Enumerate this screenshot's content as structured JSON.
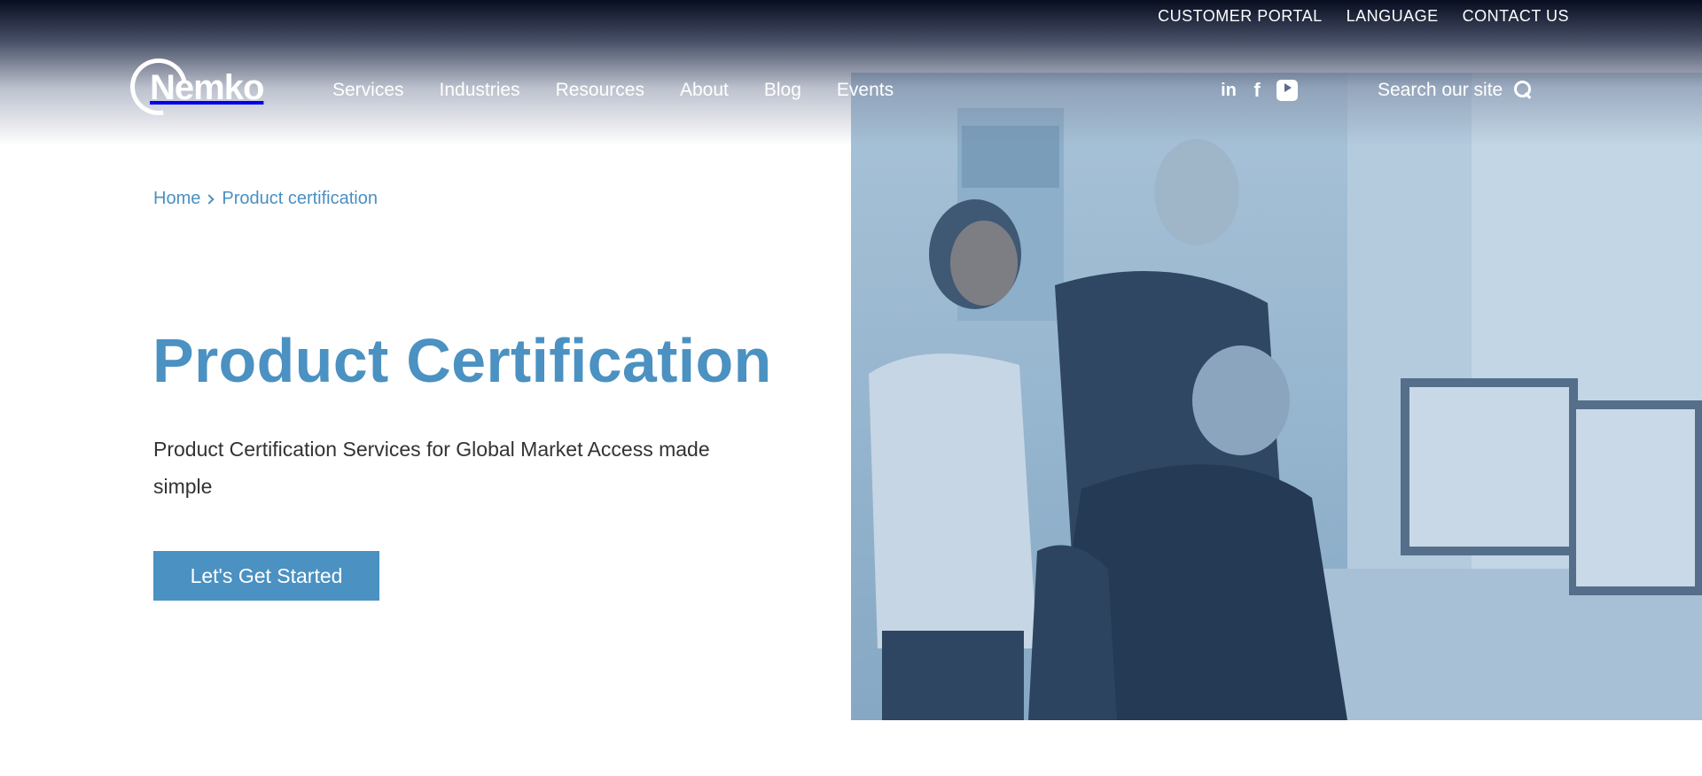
{
  "header": {
    "utility_links": [
      "CUSTOMER PORTAL",
      "LANGUAGE",
      "CONTACT US"
    ],
    "logo_text": "Nemko",
    "nav_items": [
      "Services",
      "Industries",
      "Resources",
      "About",
      "Blog",
      "Events"
    ],
    "social_icons": [
      "linkedin-icon",
      "facebook-icon",
      "youtube-icon"
    ],
    "linkedin_glyph": "in",
    "facebook_glyph": "f",
    "search_label": "Search our site"
  },
  "breadcrumb": {
    "home": "Home",
    "current": "Product certification"
  },
  "hero": {
    "title": "Product Certification",
    "subtitle": "Product Certification Services for Global Market Access made simple",
    "cta_label": "Let's Get Started"
  },
  "colors": {
    "brand_blue": "#4b91c2",
    "header_dark": "#080d20",
    "image_tint": "#97b6cf",
    "body_text": "#333333"
  }
}
